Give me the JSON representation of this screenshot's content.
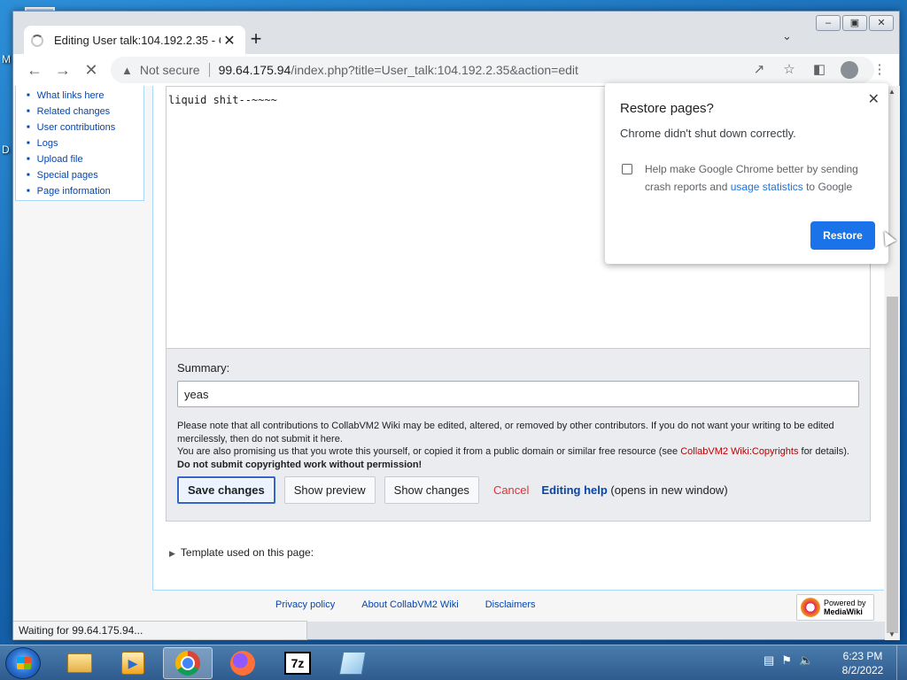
{
  "desktop": {
    "left_letters": [
      "M",
      "D"
    ]
  },
  "browser": {
    "tab_title": "Editing User talk:104.192.2.35 - C",
    "tab_close": "✕",
    "new_tab": "+",
    "security_label": "Not secure",
    "url_host": "99.64.175.94",
    "url_path": "/index.php?title=User_talk:104.192.2.35&action=edit",
    "status_text": "Waiting for 99.64.175.94..."
  },
  "sidebar": {
    "items": [
      {
        "label": "What links here"
      },
      {
        "label": "Related changes"
      },
      {
        "label": "User contributions"
      },
      {
        "label": "Logs"
      },
      {
        "label": "Upload file"
      },
      {
        "label": "Special pages"
      },
      {
        "label": "Page information"
      }
    ]
  },
  "editor": {
    "text": "liquid shit--~~~~",
    "summary_label": "Summary:",
    "summary_value": "yeas",
    "notice_line1": "Please note that all contributions to CollabVM2 Wiki may be edited, altered, or removed by other contributors. If you do not want your writing to be edited mercilessly, then do not submit it here.",
    "notice_line2a": "You are also promising us that you wrote this yourself, or copied it from a public domain or similar free resource (see ",
    "notice_link": "CollabVM2 Wiki:Copyrights",
    "notice_line2b": " for details). ",
    "notice_bold": "Do not submit copyrighted work without permission!",
    "save_label": "Save changes",
    "preview_label": "Show preview",
    "changes_label": "Show changes",
    "cancel_label": "Cancel",
    "help_label": "Editing help",
    "help_suffix": " (opens in new window)",
    "template_label": "Template used on this page:"
  },
  "footer": {
    "links": [
      "Privacy policy",
      "About CollabVM2 Wiki",
      "Disclaimers"
    ],
    "powered_line1": "Powered by",
    "powered_line2": "MediaWiki"
  },
  "restore_popup": {
    "title": "Restore pages?",
    "subtitle": "Chrome didn't shut down correctly.",
    "check_text_a": "Help make Google Chrome better by sending crash reports and ",
    "check_link": "usage statistics",
    "check_text_b": " to Google",
    "restore_label": "Restore",
    "close": "✕"
  },
  "taskbar": {
    "seven_zip_label": "7z",
    "time": "6:23 PM",
    "date": "8/2/2022"
  },
  "colors": {
    "accent": "#1a73e8",
    "wiki_link": "#0645ad",
    "cancel": "#d33333"
  }
}
